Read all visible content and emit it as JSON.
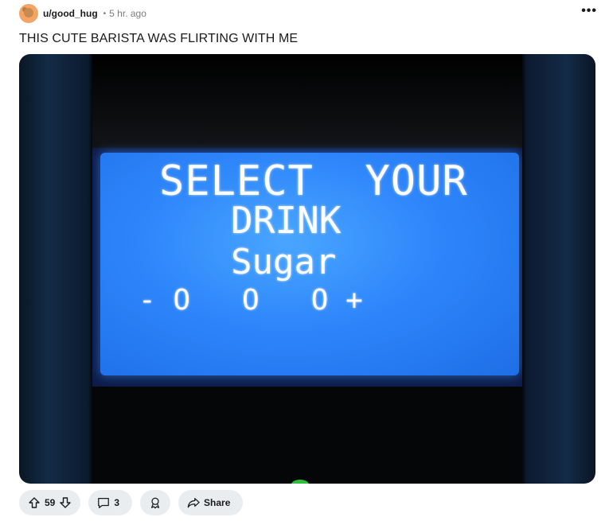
{
  "post": {
    "username": "u/good_hug",
    "separator": "•",
    "time": "5 hr. ago",
    "more": "•••",
    "title": "THIS CUTE BARISTA WAS FLIRTING WITH ME"
  },
  "media": {
    "lcd_lines": [
      "SELECT  YOUR",
      "DRINK",
      "Sugar",
      "- O   O   O +"
    ]
  },
  "actions": {
    "upvote_count": "59",
    "comments_count": "3",
    "share_label": "Share"
  },
  "colors": {
    "lcd_blue": "#2e86fb",
    "pill_bg": "#eaedef"
  },
  "icons": [
    "avatar",
    "more-icon",
    "upvote-icon",
    "downvote-icon",
    "comment-icon",
    "award-icon",
    "share-icon"
  ]
}
